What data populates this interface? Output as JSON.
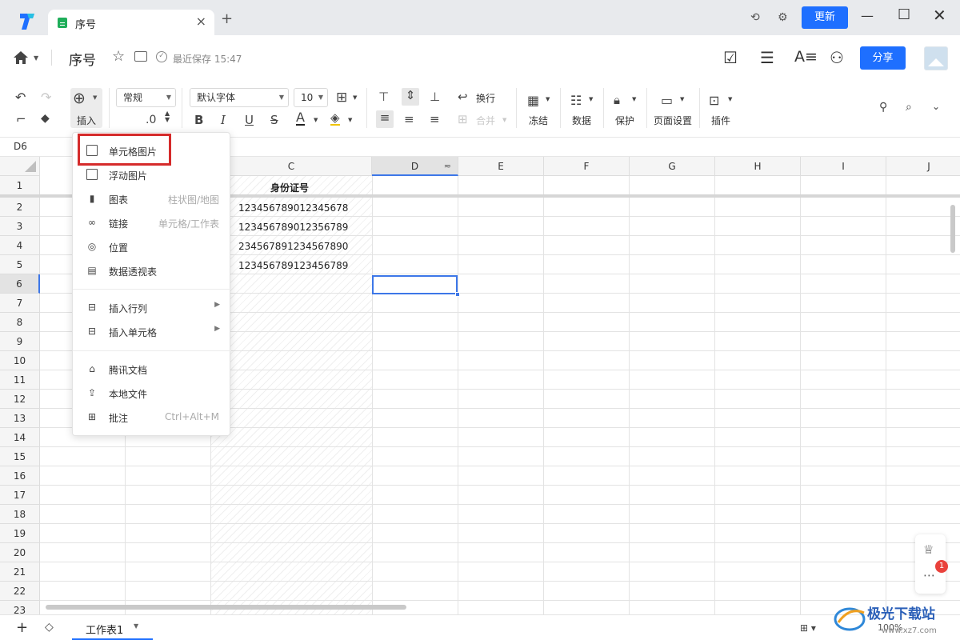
{
  "titlebar": {
    "tab_title": "序号",
    "update_label": "更新",
    "icons": [
      "app-logo-icon",
      "sync-icon",
      "settings-icon",
      "minimize-icon",
      "maximize-icon",
      "close-icon"
    ]
  },
  "docbar": {
    "title": "序号",
    "save_status": "最近保存 15:47",
    "share_label": "分享",
    "icons": [
      "home-icon",
      "star-icon",
      "move-icon",
      "task-icon",
      "menu-icon",
      "font-style-icon",
      "add-user-icon"
    ]
  },
  "ribbon": {
    "insert_label": "插入",
    "number_format": "常规",
    "decimal_label": ".0",
    "font_family": "默认字体",
    "font_size": "10",
    "wrap_label": "换行",
    "merge_label": "合并",
    "freeze_label": "冻结",
    "data_label": "数据",
    "protect_label": "保护",
    "page_setup_label": "页面设置",
    "plugin_label": "插件"
  },
  "formula_bar": {
    "cell_ref": "D6"
  },
  "grid": {
    "columns": [
      "C",
      "D",
      "E",
      "F",
      "G",
      "H",
      "I",
      "J"
    ],
    "rows": [
      "1",
      "2",
      "3",
      "4",
      "5",
      "6",
      "7",
      "8",
      "9",
      "10",
      "11",
      "12",
      "13",
      "14",
      "15",
      "16",
      "17",
      "18",
      "19",
      "20",
      "21",
      "22",
      "23"
    ],
    "selected_cell": "D6",
    "header_cell": "身份证号",
    "values": [
      "123456789012345678",
      "123456789012356789",
      "234567891234567890",
      "123456789123456789"
    ]
  },
  "insert_menu": {
    "items": [
      {
        "label": "单元格图片",
        "hint": "",
        "icon": "image-icon"
      },
      {
        "label": "浮动图片",
        "hint": "",
        "icon": "image-icon"
      },
      {
        "label": "图表",
        "hint": "柱状图/地图",
        "icon": "chart-icon"
      },
      {
        "label": "链接",
        "hint": "单元格/工作表",
        "icon": "link-icon"
      },
      {
        "label": "位置",
        "hint": "",
        "icon": "location-icon"
      },
      {
        "label": "数据透视表",
        "hint": "",
        "icon": "pivot-table-icon"
      },
      {
        "label": "插入行列",
        "hint": "",
        "icon": "insert-row-col-icon"
      },
      {
        "label": "插入单元格",
        "hint": "",
        "icon": "insert-cell-icon"
      },
      {
        "label": "腾讯文档",
        "hint": "",
        "icon": "tencent-docs-icon"
      },
      {
        "label": "本地文件",
        "hint": "",
        "icon": "upload-icon"
      },
      {
        "label": "批注",
        "hint": "Ctrl+Alt+M",
        "icon": "comment-icon"
      }
    ]
  },
  "sheetbar": {
    "sheet_name": "工作表1",
    "zoom": "100%"
  },
  "floating": {
    "badge_count": "1"
  },
  "watermark": {
    "text": "极光下载站",
    "url_text": "www.xz7.com"
  },
  "colors": {
    "accent": "#1e6fff",
    "highlight_border": "#d52b2b",
    "selection": "#3d77e8",
    "badge": "#e9413b"
  }
}
